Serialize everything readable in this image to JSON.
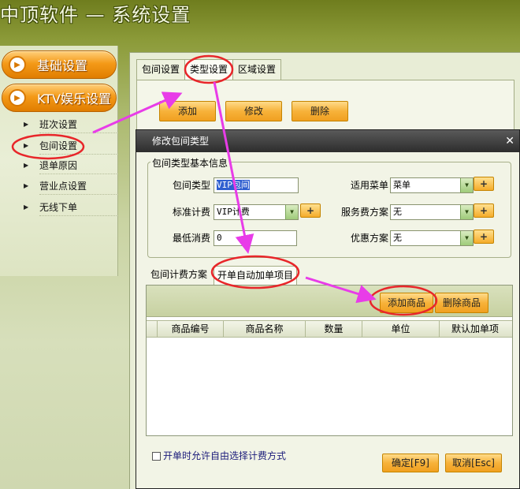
{
  "header": {
    "title": "中顶软件 — 系统设置"
  },
  "sidebar": {
    "groups": [
      {
        "label": "基础设置"
      },
      {
        "label": "KTV娱乐设置"
      }
    ],
    "items": [
      {
        "label": "班次设置"
      },
      {
        "label": "包间设置"
      },
      {
        "label": "退单原因"
      },
      {
        "label": "营业点设置"
      },
      {
        "label": "无线下单"
      }
    ]
  },
  "main": {
    "tabs": [
      {
        "label": "包间设置"
      },
      {
        "label": "类型设置"
      },
      {
        "label": "区域设置"
      }
    ],
    "toolbar": {
      "add": "添加",
      "edit": "修改",
      "delete": "删除"
    }
  },
  "dialog": {
    "title": "修改包间类型",
    "close": "✕",
    "basic_legend": "包间类型基本信息",
    "fields": {
      "room_type": {
        "label": "包间类型",
        "value": "VIP包间"
      },
      "menu": {
        "label": "适用菜单",
        "value": "菜单"
      },
      "std_billing": {
        "label": "标准计费",
        "value": "VIP计费"
      },
      "service_plan": {
        "label": "服务费方案",
        "value": "无"
      },
      "min_spend": {
        "label": "最低消费",
        "value": "0"
      },
      "discount_plan": {
        "label": "优惠方案",
        "value": "无"
      }
    },
    "plus_label": "+",
    "inner_tabs": [
      {
        "label": "包间计费方案"
      },
      {
        "label": "开单自动加单项目"
      }
    ],
    "grid_buttons": {
      "add_item": "添加商品",
      "delete_item": "删除商品"
    },
    "columns": [
      "商品编号",
      "商品名称",
      "数量",
      "单位",
      "默认加单项"
    ],
    "allow_free_billing": "开单时允许自由选择计费方式",
    "ok": "确定[F9]",
    "cancel": "取消[Esc]"
  },
  "colors": {
    "accent_orange": "#f49a18",
    "annotation_red": "#e8262a",
    "annotation_magenta": "#e83ce8"
  }
}
